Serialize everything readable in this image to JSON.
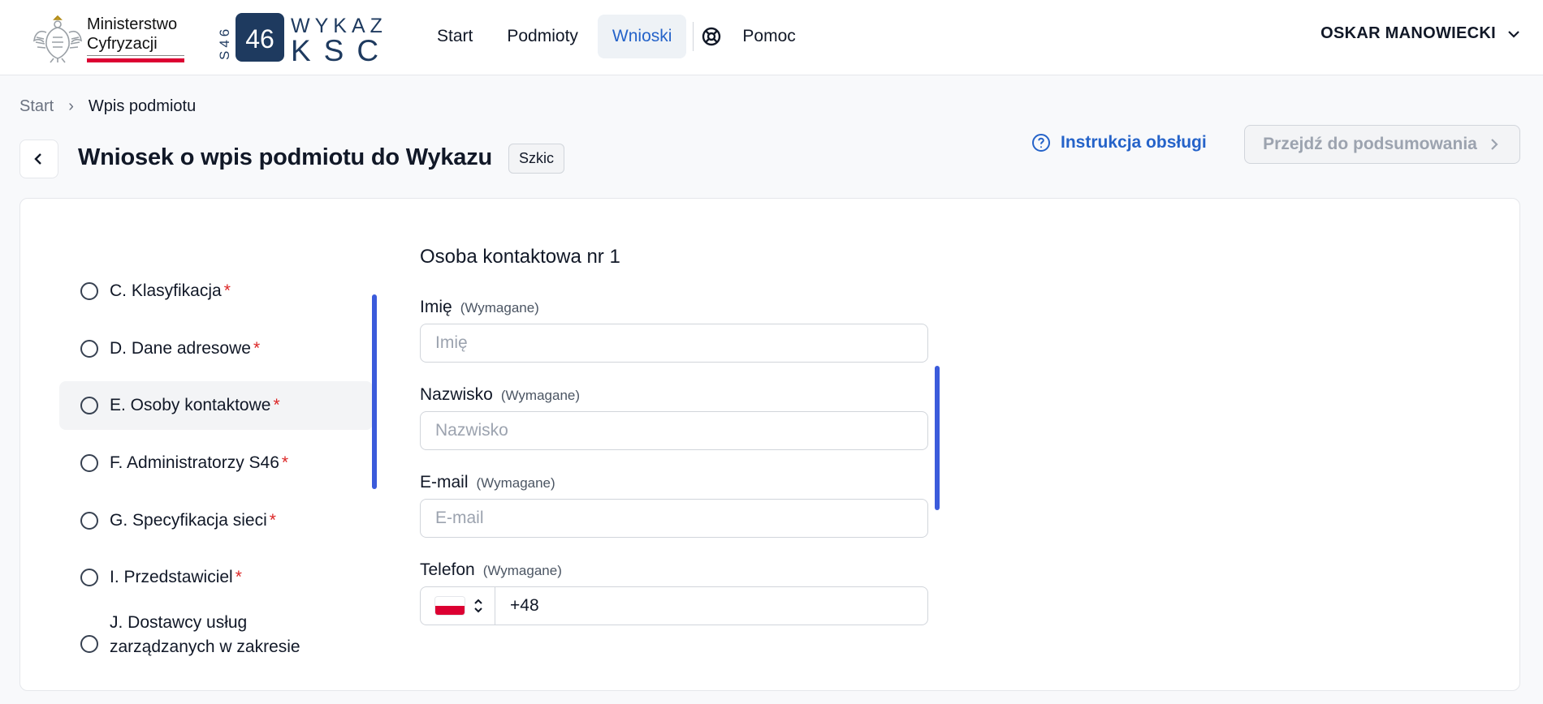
{
  "header": {
    "ministry_logo": {
      "line1": "Ministerstwo",
      "line2": "Cyfryzacji"
    },
    "ksc_logo": {
      "side": "S46",
      "mark": "46",
      "title_top": "WYKAZ",
      "title_bottom": "KSC"
    },
    "nav": [
      {
        "label": "Start",
        "active": false
      },
      {
        "label": "Podmioty",
        "active": false
      },
      {
        "label": "Wnioski",
        "active": true
      }
    ],
    "help_label": "Pomoc",
    "user_name": "OSKAR MANOWIECKI"
  },
  "breadcrumb": {
    "items": [
      "Start",
      "Wpis podmiotu"
    ],
    "separator": "›"
  },
  "title": {
    "text": "Wniosek o wpis podmiotu do Wykazu",
    "badge": "Szkic",
    "manual_link": "Instrukcja obsługi",
    "summary_button": "Przejdź do podsumowania"
  },
  "steps": [
    {
      "label": "C. Klasyfikacja",
      "required": "*",
      "active": false
    },
    {
      "label": "D. Dane adresowe",
      "required": "*",
      "active": false
    },
    {
      "label": "E. Osoby kontaktowe",
      "required": "*",
      "active": true
    },
    {
      "label": "F. Administratorzy S46",
      "required": "*",
      "active": false
    },
    {
      "label": "G. Specyfikacja sieci",
      "required": "*",
      "active": false
    },
    {
      "label": "I. Przedstawiciel",
      "required": "*",
      "active": false
    },
    {
      "label_line1": "J. Dostawcy usług",
      "label_line2": "zarządzanych w zakresie",
      "active": false
    }
  ],
  "form": {
    "section_title": "Osoba kontaktowa nr 1",
    "required_hint": "(Wymagane)",
    "fields": {
      "first_name": {
        "label": "Imię",
        "placeholder": "Imię",
        "value": ""
      },
      "last_name": {
        "label": "Nazwisko",
        "placeholder": "Nazwisko",
        "value": ""
      },
      "email": {
        "label": "E-mail",
        "placeholder": "E-mail",
        "value": ""
      },
      "phone": {
        "label": "Telefon",
        "value": "+48",
        "country": "PL"
      }
    }
  },
  "colors": {
    "accent": "#2563c9",
    "scrollbar": "#3b5bdb",
    "required": "#dc2626",
    "flag_red": "#dc0032"
  }
}
